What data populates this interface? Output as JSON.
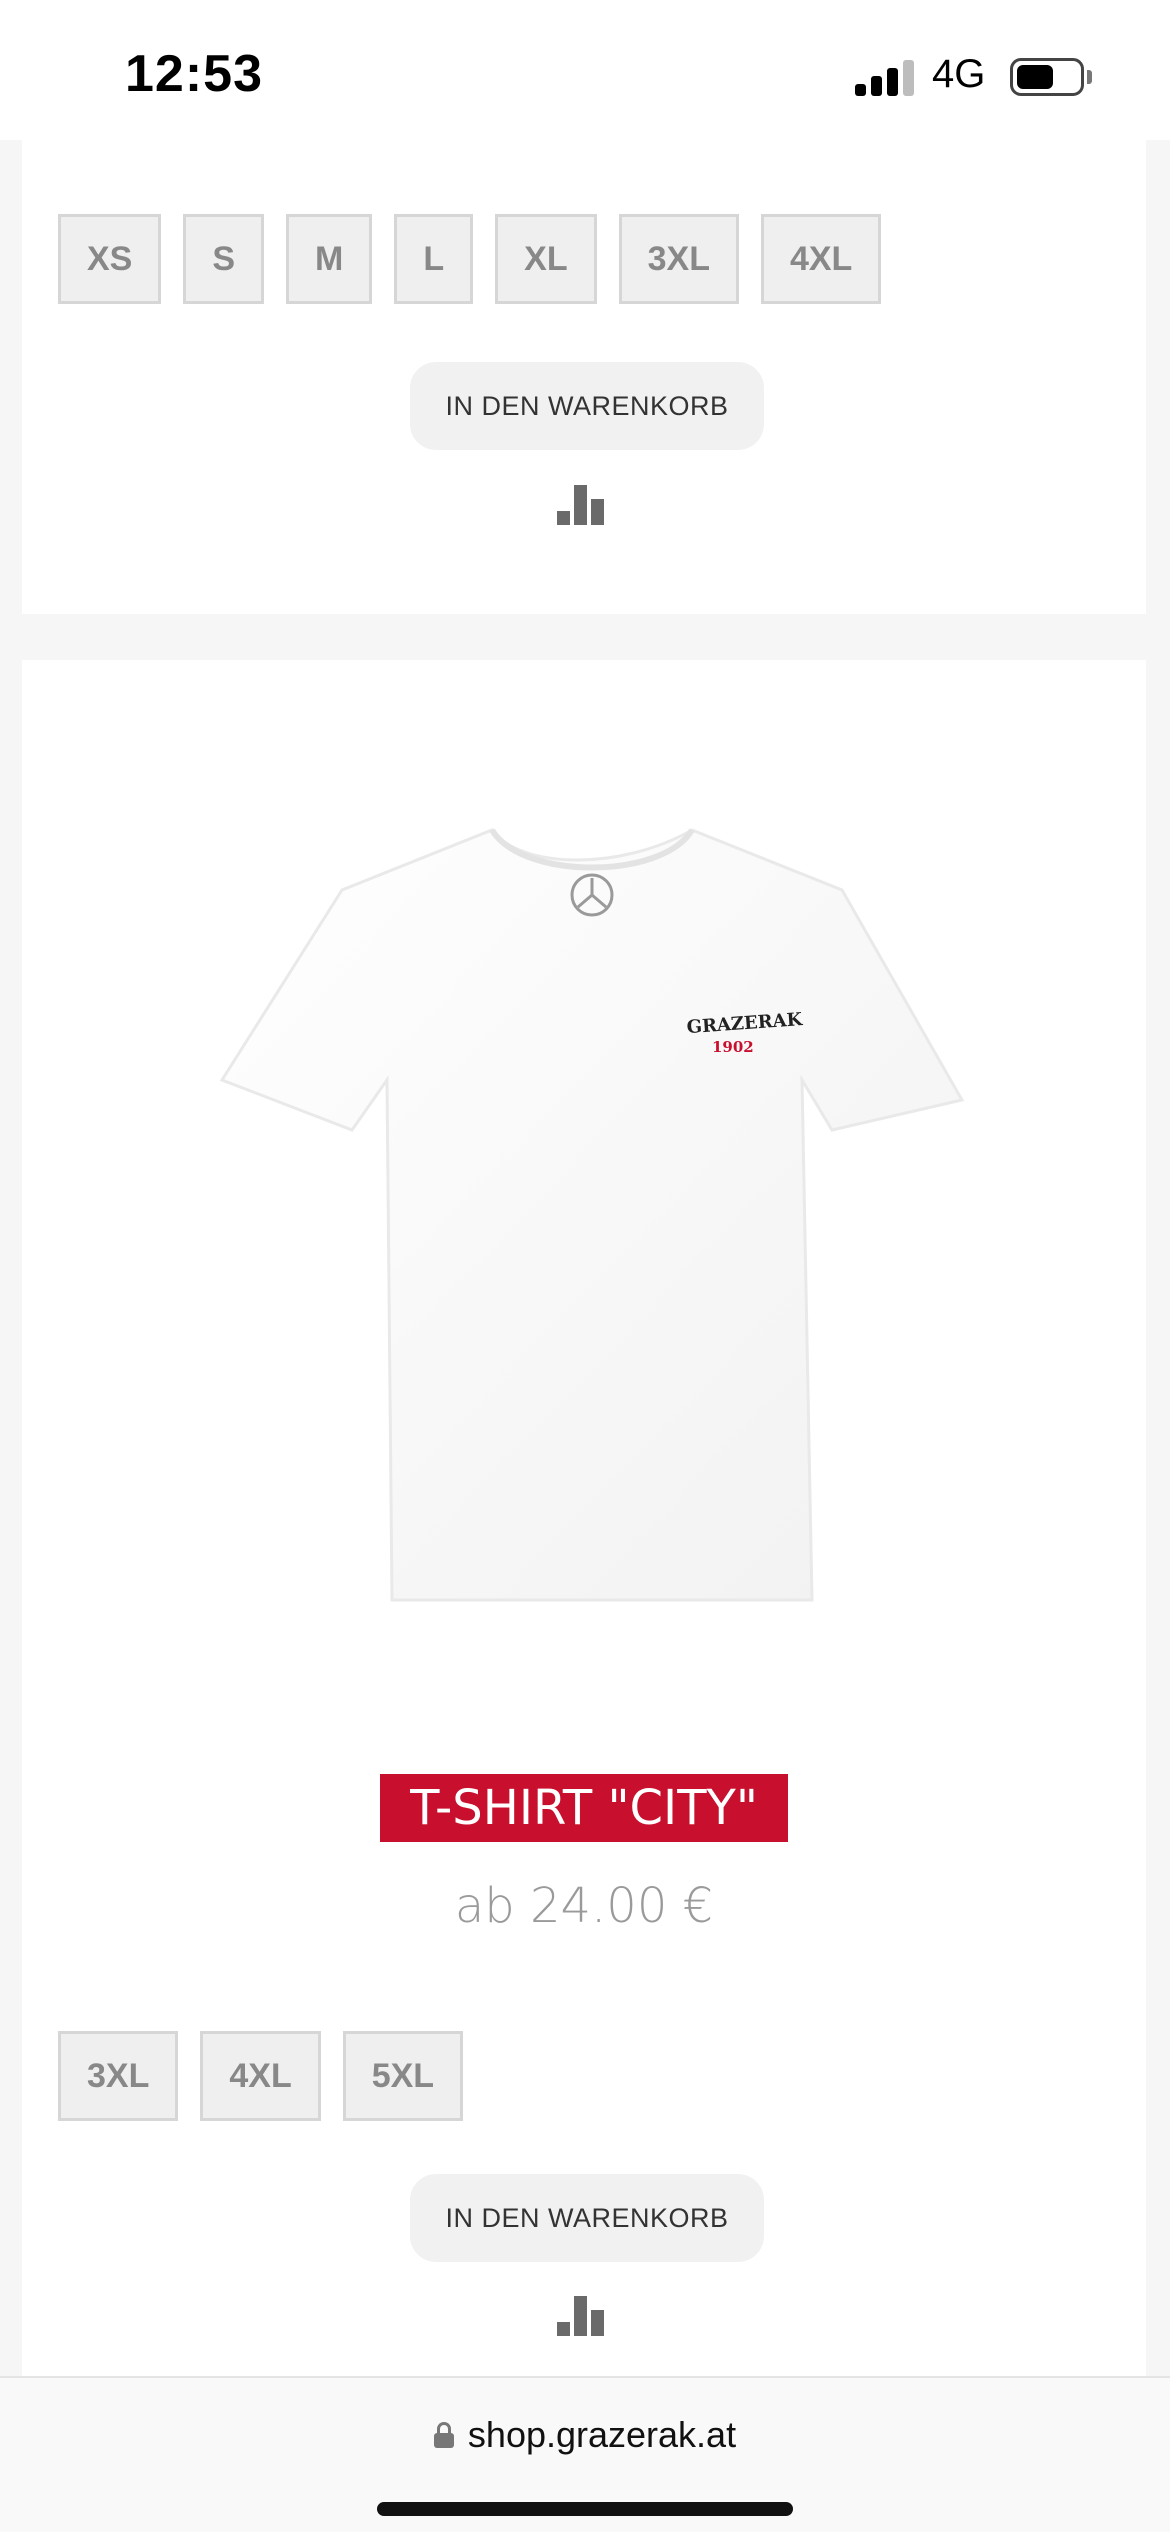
{
  "status_bar": {
    "time": "12:53",
    "network": "4G",
    "signal_bars_active": 3,
    "battery_level_fraction": 0.6
  },
  "previous_product": {
    "sizes": [
      "XS",
      "S",
      "M",
      "L",
      "XL",
      "3XL",
      "4XL"
    ],
    "cart_label": "IN DEN WARENKORB",
    "compare_icon": "bar-chart-icon"
  },
  "product": {
    "image": "white-tshirt-grazerak-logo",
    "logo_text": "GRAZERAK",
    "logo_year": "1902",
    "title": "T-SHIRT \"CITY\"",
    "price": "ab 24.00 €",
    "sizes": [
      "3XL",
      "4XL",
      "5XL"
    ],
    "cart_label": "IN DEN WARENKORB",
    "compare_icon": "bar-chart-icon"
  },
  "browser": {
    "url": "shop.grazerak.at",
    "lock_icon": "lock-icon"
  },
  "colors": {
    "title_bg": "#c8102e",
    "price_text": "#9a9a9a",
    "size_border": "#d6d6d6"
  }
}
